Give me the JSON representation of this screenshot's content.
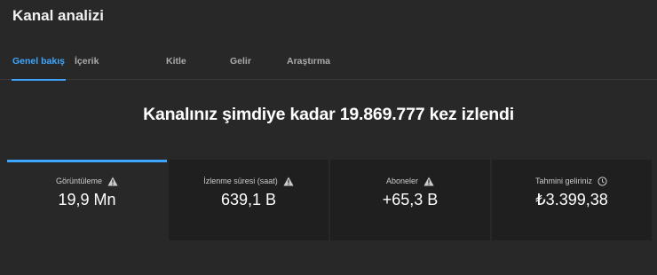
{
  "header": {
    "title": "Kanal analizi"
  },
  "tabs": [
    {
      "label": "Genel bakış",
      "active": true
    },
    {
      "label": "İçerik"
    },
    {
      "label": "Kitle"
    },
    {
      "label": "Gelir"
    },
    {
      "label": "Araştırma"
    }
  ],
  "headline": "Kanalınız şimdiye kadar 19.869.777 kez izlendi",
  "cards": [
    {
      "label": "Görüntüleme",
      "value": "19,9 Mn",
      "icon": "warning-icon",
      "selected": true
    },
    {
      "label": "İzlenme süresi (saat)",
      "value": "639,1 B",
      "icon": "warning-icon"
    },
    {
      "label": "Aboneler",
      "value": "+65,3 B",
      "icon": "warning-icon"
    },
    {
      "label": "Tahmini geliriniz",
      "value": "₺3.399,38",
      "icon": "clock-icon"
    }
  ],
  "colors": {
    "accent": "#3ea6ff",
    "background": "#282828",
    "card_background": "#1f1f1f"
  }
}
